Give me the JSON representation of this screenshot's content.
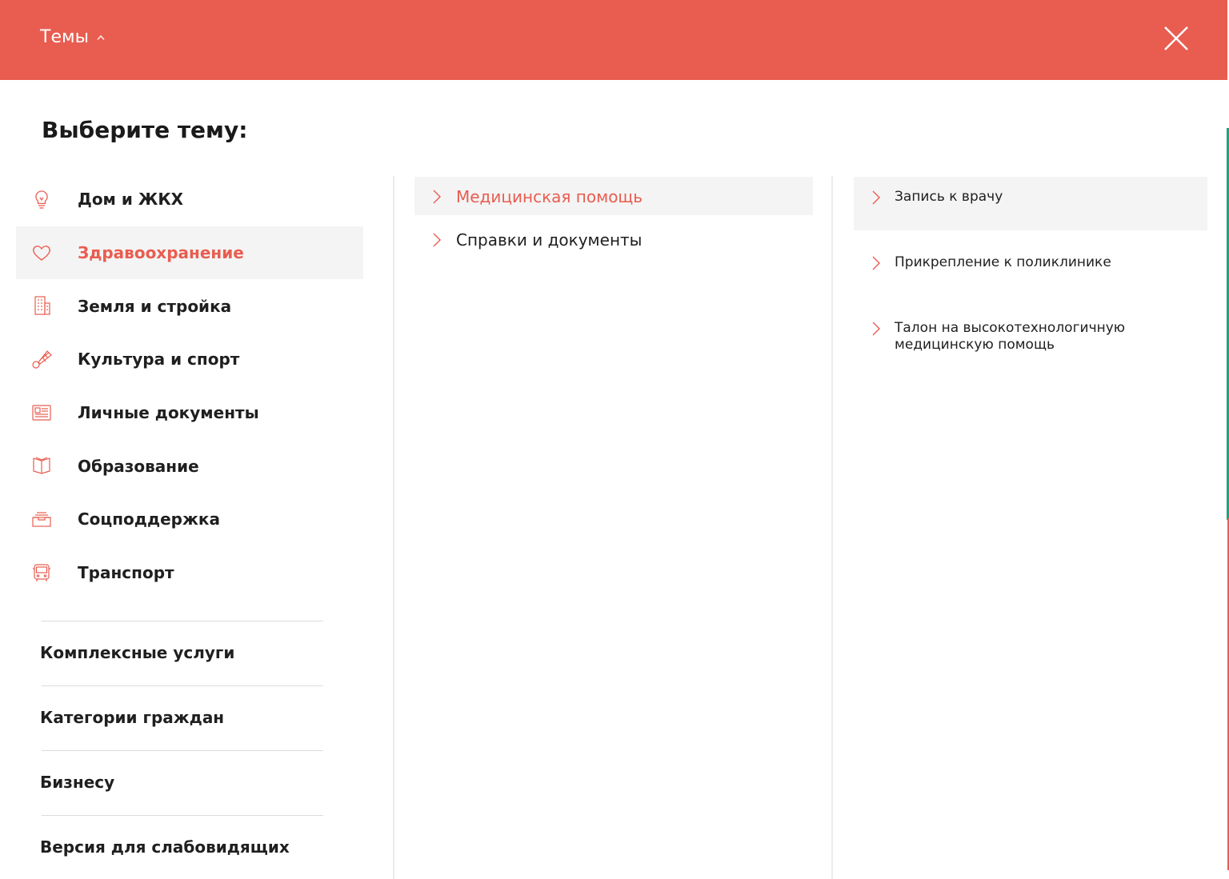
{
  "header": {
    "title": "Темы",
    "chevron_icon": "chevron-up-icon",
    "close_icon": "close-icon",
    "background": "#e85d50"
  },
  "heading": "Выберите тему:",
  "topics": [
    {
      "label": "Дом и ЖКХ",
      "icon": "lightbulb-icon",
      "active": false
    },
    {
      "label": "Здравоохранение",
      "icon": "heart-icon",
      "active": true
    },
    {
      "label": "Земля и стройка",
      "icon": "building-icon",
      "active": false
    },
    {
      "label": "Культура и спорт",
      "icon": "shuttlecock-icon",
      "active": false
    },
    {
      "label": "Личные документы",
      "icon": "document-icon",
      "active": false
    },
    {
      "label": "Образование",
      "icon": "book-icon",
      "active": false
    },
    {
      "label": "Соцподдержка",
      "icon": "inbox-icon",
      "active": false
    },
    {
      "label": "Транспорт",
      "icon": "bus-icon",
      "active": false
    }
  ],
  "extra_links": [
    {
      "label": "Комплексные услуги"
    },
    {
      "label": "Категории граждан"
    },
    {
      "label": "Бизнесу"
    },
    {
      "label": "Версия для слабовидящих"
    }
  ],
  "subtopics": [
    {
      "label": "Медицинская помощь",
      "active": true
    },
    {
      "label": "Справки и документы",
      "active": false
    }
  ],
  "services": [
    {
      "label": "Запись к врачу",
      "active": true
    },
    {
      "label": "Прикрепление к поликлинике",
      "active": false
    },
    {
      "label": "Талон на высокотехнологичную медицинскую помощь",
      "active": false
    }
  ],
  "colors": {
    "accent": "#e85d50",
    "active_bg": "#f4f4f4",
    "text": "#1f1f1f"
  }
}
